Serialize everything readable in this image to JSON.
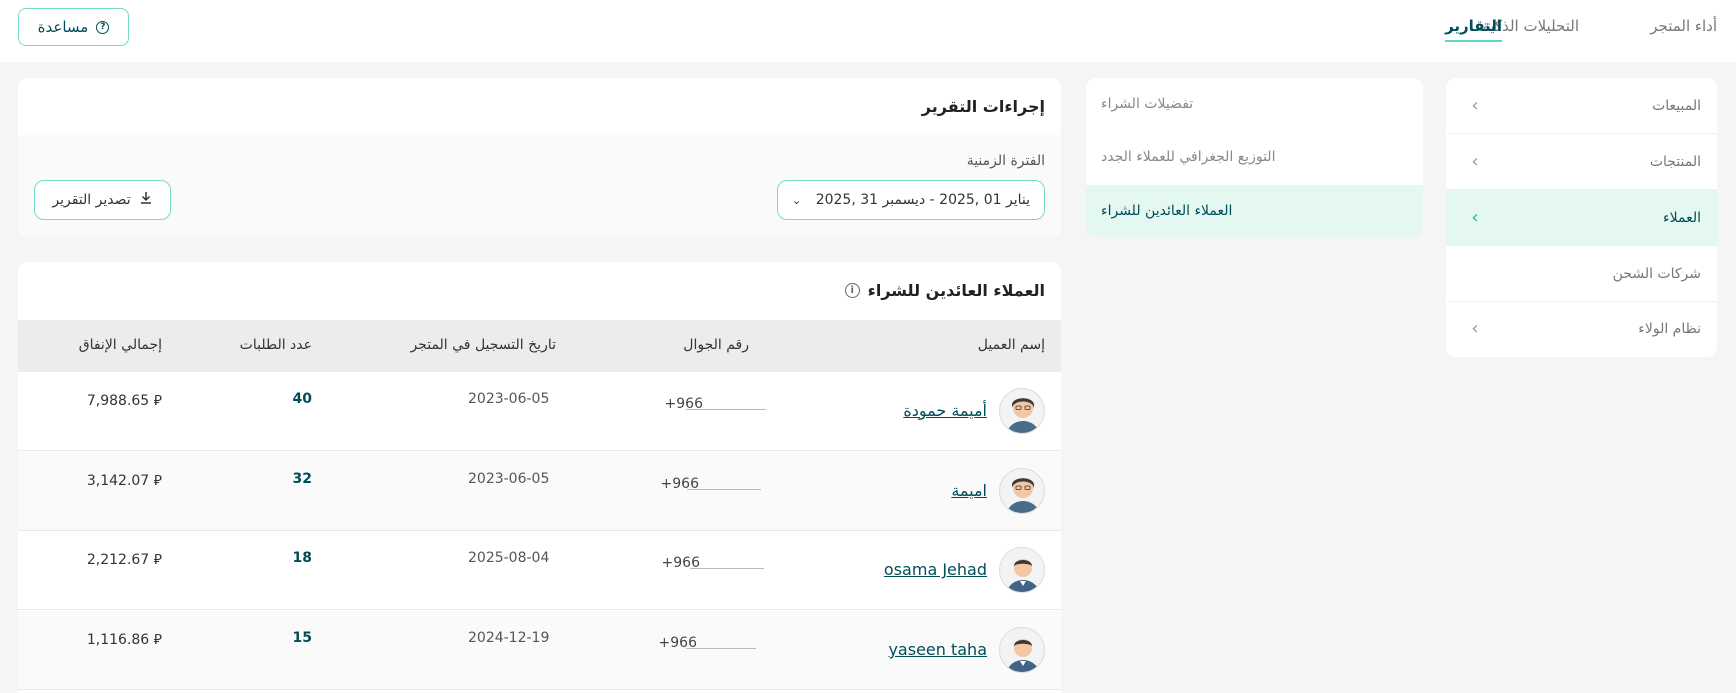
{
  "top_nav": {
    "tabs": [
      {
        "label": "أداء المتجر"
      },
      {
        "label": "التحليلات الذكية"
      },
      {
        "label": "التقارير"
      }
    ],
    "help_label": "مساعدة"
  },
  "main_menu": {
    "items": [
      {
        "label": "المبيعات"
      },
      {
        "label": "المنتجات"
      },
      {
        "label": "العملاء"
      },
      {
        "label": "شركات الشحن"
      },
      {
        "label": "نظام الولاء"
      }
    ]
  },
  "sub_menu": {
    "items": [
      {
        "label": "تفضيلات الشراء"
      },
      {
        "label": "التوزيع الجغرافي للعملاء الجدد"
      },
      {
        "label": "العملاء العائدين للشراء"
      }
    ]
  },
  "report_actions": {
    "title": "إجراءات التقرير",
    "period_label": "الفترة الزمنية",
    "date_range": "يناير 01 ,2025  -  ديسمبر 31 ,2025",
    "export_label": "تصدير التقرير"
  },
  "table": {
    "title": "العملاء العائدين للشراء",
    "headers": {
      "name": "إسم العميل",
      "phone": "رقم الجوال",
      "registered": "تاريخ التسجيل في المتجر",
      "orders": "عدد الطلبات",
      "spend": "إجمالي الإنفاق"
    },
    "rows": [
      {
        "name": "أميمة حمودة",
        "phone": "+966",
        "registered": "2023-06-05",
        "orders": "40",
        "spend": "7,988.65 ⃁"
      },
      {
        "name": "اميمة",
        "phone": "+966",
        "registered": "2023-06-05",
        "orders": "32",
        "spend": "3,142.07 ⃁"
      },
      {
        "name": "osama Jehad",
        "phone": "+966",
        "registered": "2025-08-04",
        "orders": "18",
        "spend": "2,212.67 ⃁"
      },
      {
        "name": "yaseen taha",
        "phone": "+966",
        "registered": "2024-12-19",
        "orders": "15",
        "spend": "1,116.86 ⃁"
      }
    ]
  },
  "colors": {
    "accent": "#5ad8c1",
    "brand": "#004d5a",
    "active_bg": "#e4f7f1"
  }
}
